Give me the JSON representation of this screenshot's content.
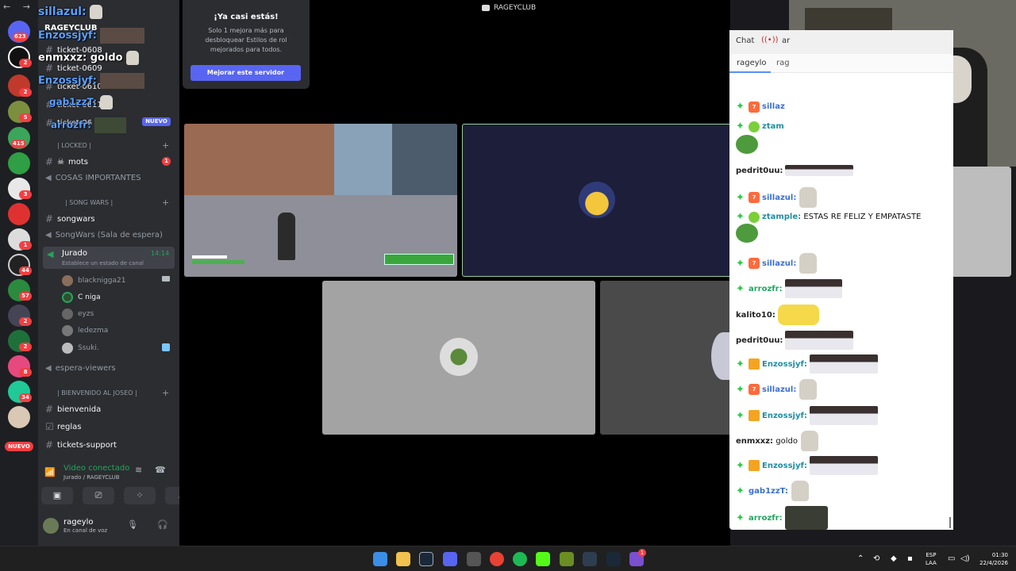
{
  "window": {
    "title": "RAGEYCLUB"
  },
  "rail": {
    "nav": "← →",
    "badges": [
      "623",
      "2",
      "2",
      "5",
      "415",
      "3",
      "1",
      "44",
      "57",
      "2",
      "2",
      "8",
      "34"
    ],
    "new_label": "NUEVO"
  },
  "server": {
    "name": "RAGEYCLUB",
    "channels_top": [
      "ticket-0608",
      "ticket-0609",
      "ticket-0610",
      "ticket-0611",
      "ticket-06"
    ],
    "nuevo_label": "NUEVO",
    "cat_locked": "| LOCKED |",
    "mots": "mots",
    "mots_badge": "1",
    "cosas": "COSAS IMPORTANTES",
    "cat_songwars": "| SONG WARS |",
    "songwars": "songwars",
    "songwars_lobby": "SongWars (Sala de espera)",
    "jurado": {
      "name": "Jurado",
      "status": "Establece un estado de canal",
      "time": "14:14"
    },
    "voice_users": [
      "blacknigga21",
      "C niga",
      "eyzs",
      "ledezma",
      "Ssuki."
    ],
    "espera": "espera-viewers",
    "cat_bienvenida": "| BIENVENIDO AL JOSEO |",
    "bienvenida": "bienvenida",
    "reglas": "reglas",
    "tickets_support": "tickets-support"
  },
  "overlay_chat": [
    {
      "user": "sillazul:"
    },
    {
      "user": "Enzossjyf:"
    },
    {
      "user": "enmxxz:",
      "text": "goldo"
    },
    {
      "user": "Enzossjyf:"
    },
    {
      "user": "gab1zzT:"
    },
    {
      "user": "arrozfr:"
    }
  ],
  "voice_panel": {
    "status": "Video conectado",
    "location": "Jurado / RAGEYCLUB"
  },
  "user_panel": {
    "name": "rageylo",
    "status": "En canal de voz"
  },
  "upsell": {
    "title": "¡Ya casi estás!",
    "body": "Solo 1 mejora más para desbloquear Estilos de rol mejorados para todos.",
    "button": "Mejorar este servidor"
  },
  "chat": {
    "tab_chat": "Chat",
    "tab_user": "rageylo",
    "tab_user2": "rag",
    "tab_radio": "ar",
    "messages": [
      {
        "user": "sillaz",
        "text": "",
        "color": "blue"
      },
      {
        "user": "ztam",
        "text": "",
        "color": "teal"
      },
      {
        "user": "pedrit0uu:",
        "text": "",
        "color": "dark"
      },
      {
        "user": "sillazul:",
        "text": "",
        "color": "blue"
      },
      {
        "user": "ztample:",
        "text": "ESTAS RE FELIZ Y EMPATASTE",
        "color": "teal"
      },
      {
        "user": "sillazul:",
        "text": "",
        "color": "blue"
      },
      {
        "user": "arrozfr:",
        "text": "",
        "color": "green"
      },
      {
        "user": "kalito10:",
        "text": "",
        "color": "dark"
      },
      {
        "user": "pedrit0uu:",
        "text": "",
        "color": "dark"
      },
      {
        "user": "Enzossjyf:",
        "text": "",
        "color": "teal"
      },
      {
        "user": "sillazul:",
        "text": "",
        "color": "blue"
      },
      {
        "user": "Enzossjyf:",
        "text": "",
        "color": "teal"
      },
      {
        "user": "enmxxz:",
        "text": "goldo",
        "color": "dark"
      },
      {
        "user": "Enzossjyf:",
        "text": "",
        "color": "teal"
      },
      {
        "user": "gab1zzT:",
        "text": "",
        "color": "blue"
      },
      {
        "user": "arrozfr:",
        "text": "",
        "color": "green"
      }
    ]
  },
  "taskbar": {
    "lang1": "ESP",
    "lang2": "LAA",
    "time": "01:30",
    "date": "22/4/2026",
    "discord_badge": "1"
  },
  "icons": [
    "hash-icon",
    "speaker-icon",
    "signal-icon",
    "mic-icon",
    "headphones-icon",
    "gear-icon",
    "camera-icon",
    "screen-share-icon",
    "activity-icon",
    "soundboard-icon",
    "disconnect-icon"
  ],
  "colors": {
    "accent": "#5865f2",
    "online": "#23a55a",
    "danger": "#f23f42"
  }
}
